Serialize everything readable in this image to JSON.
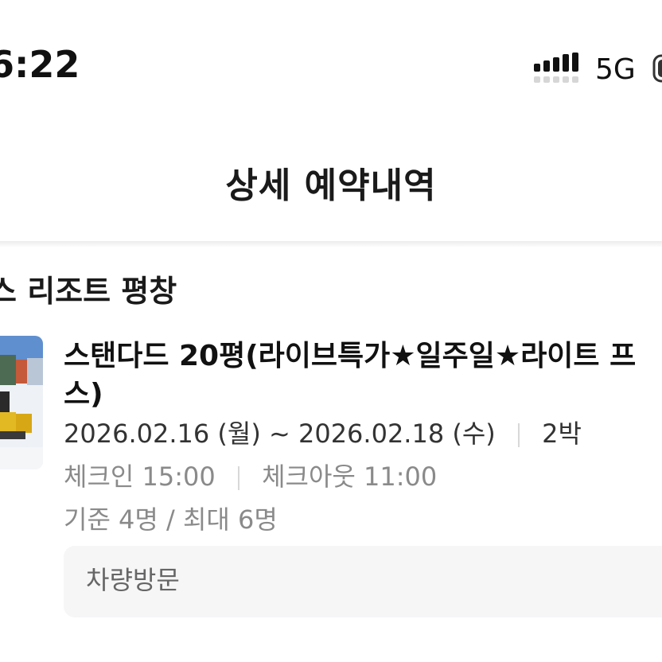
{
  "status_bar": {
    "time": "6:22",
    "network": "5G",
    "signal_icon": "cellular-signal-icon",
    "battery_icon": "battery-icon"
  },
  "header": {
    "title": "상세 예약내역"
  },
  "reservation": {
    "resort_name": "스 리조트 평창",
    "room_name_line1": "스탠다드 20평(라이브특가★일주일★라이트 프",
    "room_name_line2": "스)",
    "check_in_date": "2026.02.16 (월)",
    "date_separator": "~",
    "check_out_date": "2026.02.18 (수)",
    "nights": "2박",
    "check_in_time": "체크인 15:00",
    "check_out_time": "체크아웃 11:00",
    "capacity": "기준 4명 / 최대 6명",
    "note": "차량방문"
  },
  "colors": {
    "text_primary": "#1a1a1a",
    "text_secondary": "#8a8a8a",
    "note_background": "#f6f6f7"
  }
}
